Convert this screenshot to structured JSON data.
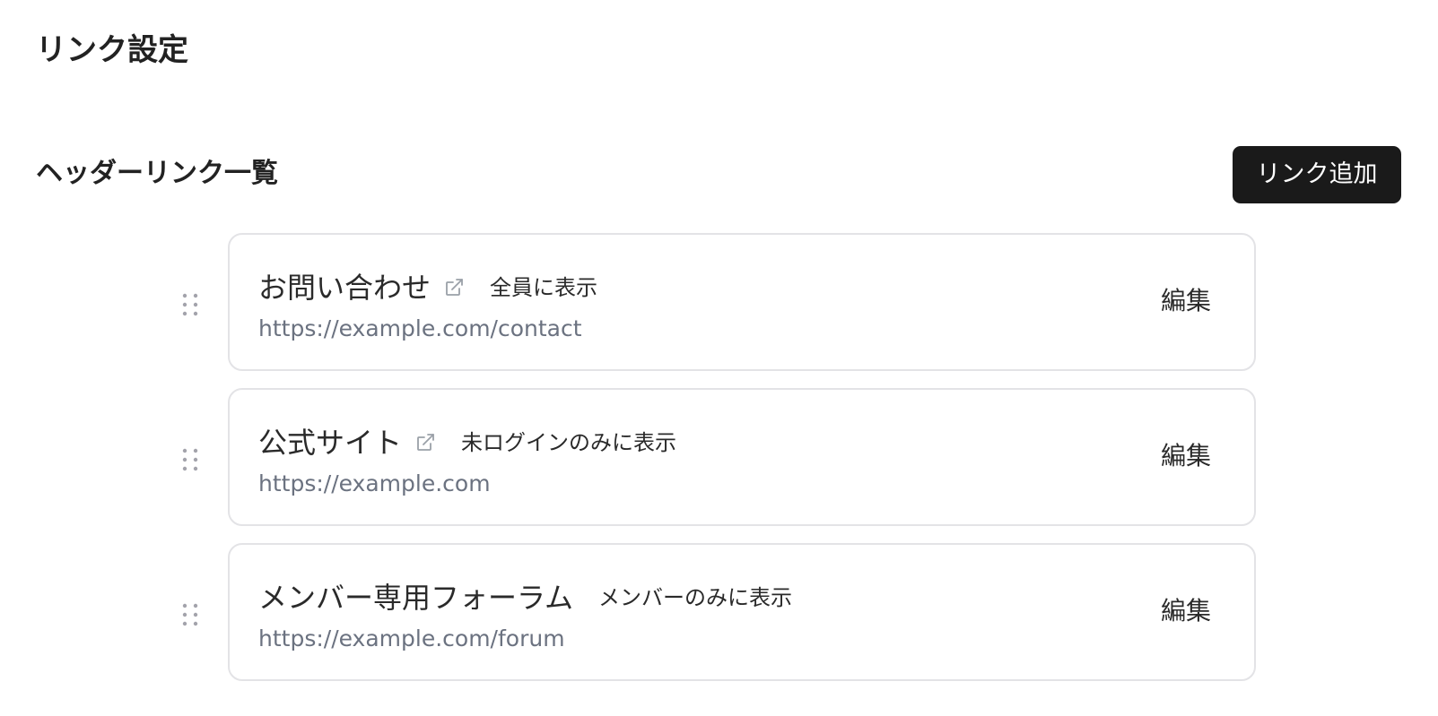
{
  "page": {
    "title": "リンク設定"
  },
  "section": {
    "title": "ヘッダーリンク一覧",
    "add_button_label": "リンク追加"
  },
  "links": [
    {
      "name": "お問い合わせ",
      "external": true,
      "visibility": "全員に表示",
      "url": "https://example.com/contact",
      "edit_label": "編集"
    },
    {
      "name": "公式サイト",
      "external": true,
      "visibility": "未ログインのみに表示",
      "url": "https://example.com",
      "edit_label": "編集"
    },
    {
      "name": "メンバー専用フォーラム",
      "external": false,
      "visibility": "メンバーのみに表示",
      "url": "https://example.com/forum",
      "edit_label": "編集"
    }
  ],
  "icons": {
    "drag_handle": "drag-handle-icon",
    "external_link": "external-link-icon"
  },
  "colors": {
    "primary_button_bg": "#1a1a1a",
    "url_text": "#6b7280",
    "card_border": "#e3e3e6"
  }
}
